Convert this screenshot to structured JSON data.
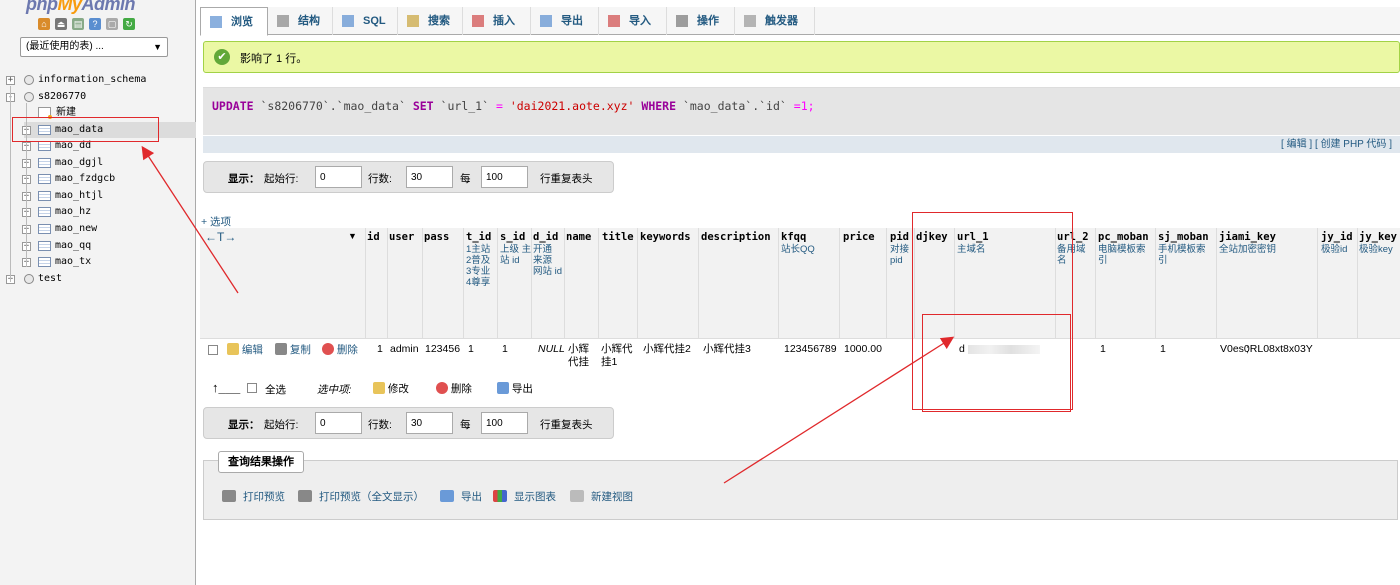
{
  "left": {
    "logo_php": "php",
    "logo_my": "My",
    "logo_admin": "Admin",
    "recent_select": "(最近使用的表) ...",
    "tree": [
      {
        "label": "information_schema"
      },
      {
        "label": "s8206770"
      },
      {
        "label": "新建"
      },
      {
        "label": "mao_data"
      },
      {
        "label": "mao_dd"
      },
      {
        "label": "mao_dgjl"
      },
      {
        "label": "mao_fzdgcb"
      },
      {
        "label": "mao_htjl"
      },
      {
        "label": "mao_hz"
      },
      {
        "label": "mao_new"
      },
      {
        "label": "mao_qq"
      },
      {
        "label": "mao_tx"
      },
      {
        "label": "test"
      }
    ]
  },
  "tabs": [
    {
      "label": "浏览"
    },
    {
      "label": "结构"
    },
    {
      "label": "SQL"
    },
    {
      "label": "搜索"
    },
    {
      "label": "插入"
    },
    {
      "label": "导出"
    },
    {
      "label": "导入"
    },
    {
      "label": "操作"
    },
    {
      "label": "触发器"
    }
  ],
  "success_msg": "影响了 1 行。",
  "sql": {
    "kw_update": "UPDATE",
    "t1": "`s8206770`.`mao_data`",
    "kw_set": "SET",
    "col": "`url_1`",
    "eq": "=",
    "val": "'dai2021.aote.xyz'",
    "kw_where": "WHERE",
    "cond": "`mao_data`.`id`",
    "eq2": "=",
    "num": "1",
    "semi": ";"
  },
  "sqlbar": "[ 编辑 ] [ 创建 PHP 代码 ]",
  "display": {
    "label": "显示：",
    "start_label": "起始行:",
    "start_value": "0",
    "rows_label": "行数:",
    "rows_value": "30",
    "every_label": "每",
    "every_value": "100",
    "repeat_label": "行重复表头"
  },
  "options_link": "+ 选项",
  "arrows": "←T→",
  "columns": [
    {
      "name": "id",
      "sub": ""
    },
    {
      "name": "user",
      "sub": ""
    },
    {
      "name": "pass",
      "sub": ""
    },
    {
      "name": "t_id",
      "sub": "1主站 2普及 3专业 4尊享"
    },
    {
      "name": "s_id",
      "sub": "上级 主站 id"
    },
    {
      "name": "d_id",
      "sub": "开通 来源 网站 id"
    },
    {
      "name": "name",
      "sub": ""
    },
    {
      "name": "title",
      "sub": ""
    },
    {
      "name": "keywords",
      "sub": ""
    },
    {
      "name": "description",
      "sub": ""
    },
    {
      "name": "kfqq",
      "sub": "站长QQ"
    },
    {
      "name": "price",
      "sub": ""
    },
    {
      "name": "pid",
      "sub": "对接 pid"
    },
    {
      "name": "djkey",
      "sub": ""
    },
    {
      "name": "url_1",
      "sub": "主域名"
    },
    {
      "name": "url_2",
      "sub": "备用域 名"
    },
    {
      "name": "pc_moban",
      "sub": "电脑模板索 引"
    },
    {
      "name": "sj_moban",
      "sub": "手机模板索 引"
    },
    {
      "name": "jiami_key",
      "sub": "全站加密密钥"
    },
    {
      "name": "jy_id",
      "sub": "极验id"
    },
    {
      "name": "jy_key",
      "sub": "极验key"
    }
  ],
  "row_actions": {
    "edit": "编辑",
    "copy": "复制",
    "delete": "删除"
  },
  "row": {
    "id": "1",
    "user": "admin",
    "pass": "123456",
    "t_id": "1",
    "s_id": "1",
    "d_id": "NULL",
    "name": "小辉 代挂",
    "title": "小辉代 挂1",
    "keywords": "小辉代挂2",
    "description": "小辉代挂3",
    "kfqq": "123456789",
    "price": "1000.00",
    "url_1": "d",
    "url_1_tail": ";",
    "pc_moban": "1",
    "sj_moban": "1",
    "jiami_key": "V0es0RL08xt8x03Y"
  },
  "with_selected": {
    "check_all": "全选",
    "label": "选中项:",
    "edit": "修改",
    "delete": "删除",
    "export": "导出"
  },
  "query_ops": {
    "legend": "查询结果操作",
    "print": "打印预览",
    "print_full": "打印预览（全文显示）",
    "export": "导出",
    "chart": "显示图表",
    "view": "新建视图"
  },
  "colors": {
    "link": "#235a81",
    "success_bg": "#ebf8a4",
    "annotation_red": "#e0292c"
  }
}
